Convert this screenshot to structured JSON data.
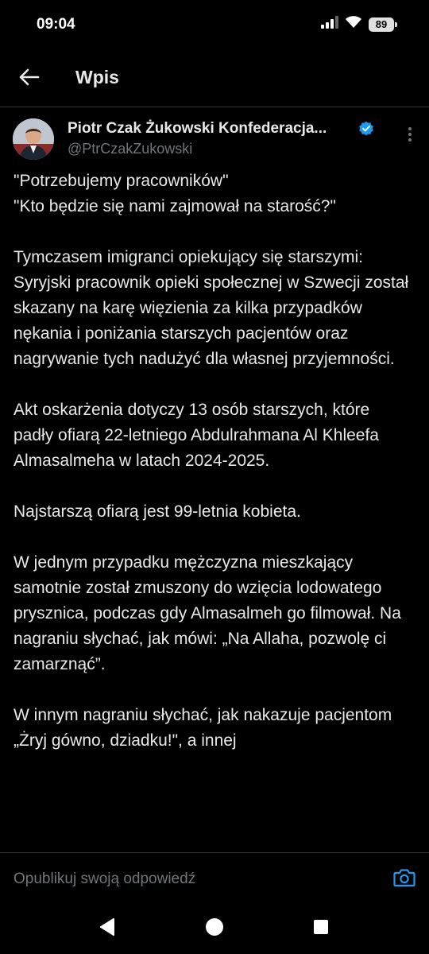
{
  "status_bar": {
    "time": "09:04",
    "battery": "89",
    "icons": [
      "signal-icon",
      "wifi-icon",
      "battery-icon"
    ]
  },
  "header": {
    "title": "Wpis",
    "back_icon": "arrow-left-icon"
  },
  "post": {
    "author": {
      "display_name": "Piotr Czak Żukowski Konfederacja...",
      "handle": "@PtrCzakZukowski",
      "verified": true,
      "verified_color": "#1d9bf0"
    },
    "paragraphs": [
      "\"Potrzebujemy pracowników\"\n\"Kto będzie się nami zajmował na starość?\"",
      "Tymczasem imigranci opiekujący się starszymi:\nSyryjski pracownik opieki społecznej w Szwecji został skazany na karę więzienia za kilka przypadków nękania i poniżania starszych pacjentów oraz nagrywanie tych nadużyć dla własnej przyjemności.",
      "Akt oskarżenia dotyczy 13 osób starszych, które padły ofiarą 22-letniego Abdulrahmana Al Khleefa Almasalmeha w latach 2024-2025.",
      "Najstarszą ofiarą jest 99-letnia kobieta.",
      "W jednym przypadku mężczyzna mieszkający samotnie został zmuszony do wzięcia lodowatego prysznica, podczas gdy Almasalmeh go filmował. Na nagraniu słychać, jak mówi: „Na Allaha, pozwolę ci zamarznąć”.",
      "W innym nagraniu słychać, jak nakazuje pacjentom „Żryj gówno, dziadku!\", a innej"
    ]
  },
  "reply": {
    "placeholder": "Opublikuj swoją odpowiedź",
    "camera_icon": "camera-icon"
  },
  "nav": [
    "back-triangle-icon",
    "home-circle-icon",
    "recents-square-icon"
  ],
  "colors": {
    "background": "#000000",
    "text": "#e7e9ea",
    "secondary": "#71767b",
    "accent": "#1d9bf0",
    "divider": "#2f3336"
  }
}
